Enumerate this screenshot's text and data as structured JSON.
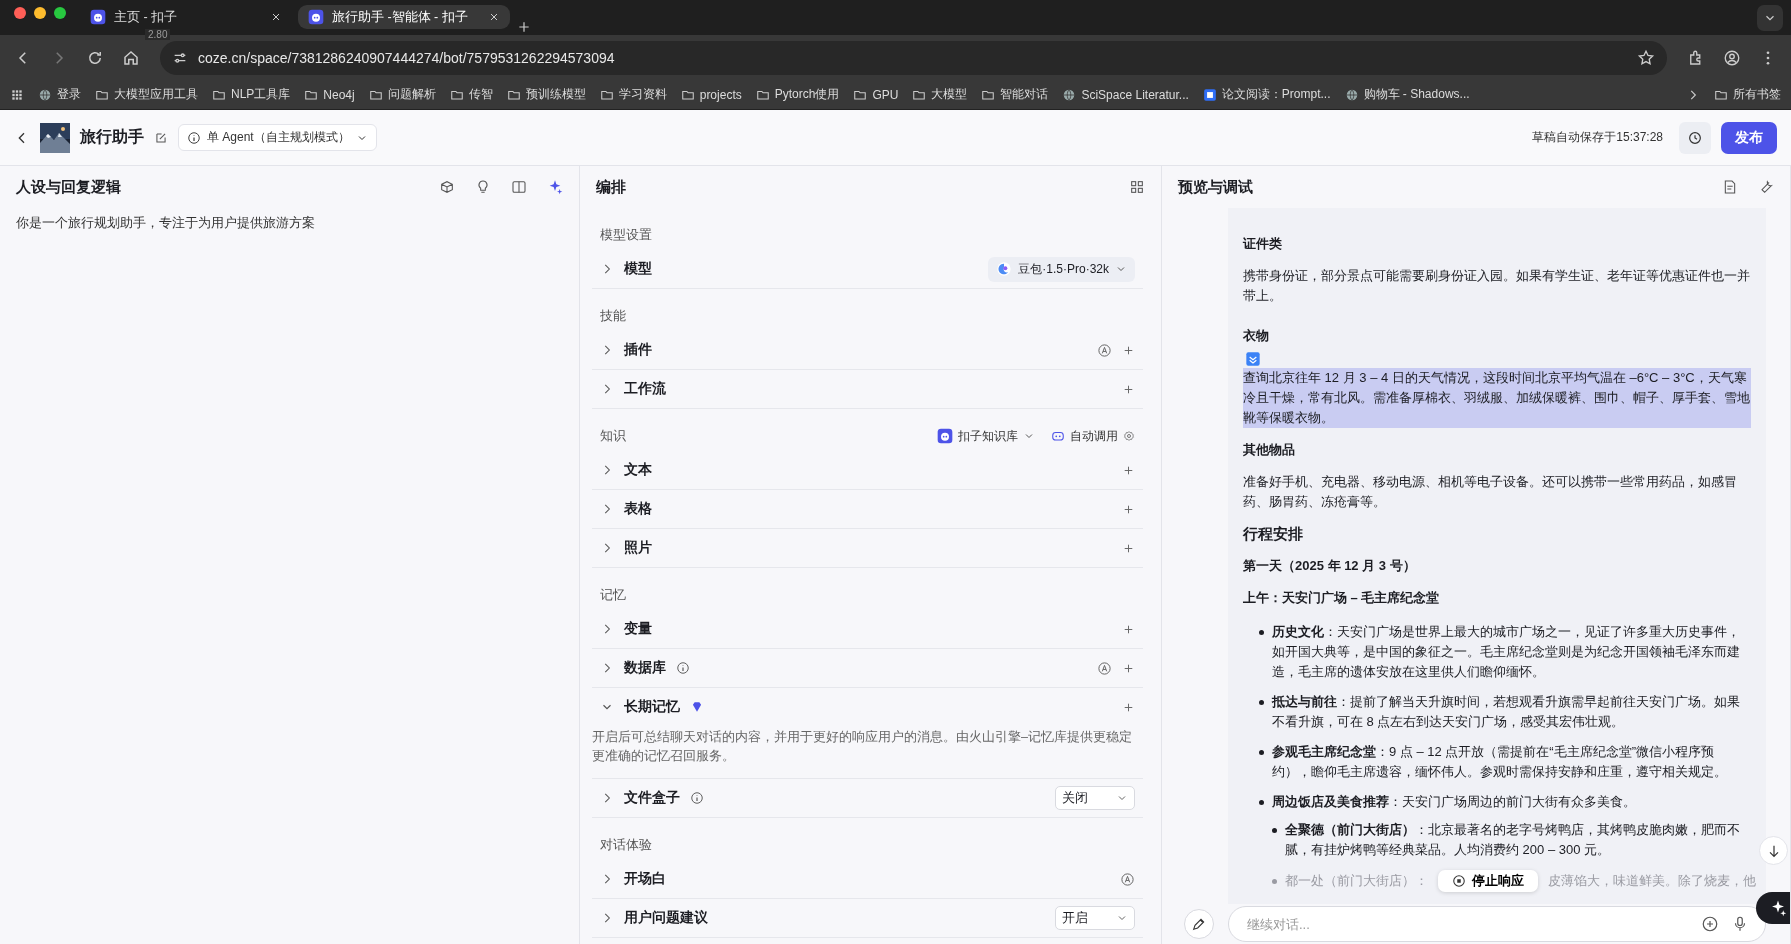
{
  "browser": {
    "tabs": [
      {
        "title": "主页 - 扣子",
        "selected": false
      },
      {
        "title": "旅行助手 -智能体 - 扣子",
        "selected": true
      }
    ],
    "tab_overlay": "2.80",
    "url": "coze.cn/space/7381286240907444274/bot/7579531262294573094",
    "bookmarks": [
      {
        "label": "登录",
        "kind": "site"
      },
      {
        "label": "大模型应用工具",
        "kind": "folder"
      },
      {
        "label": "NLP工具库",
        "kind": "folder"
      },
      {
        "label": "Neo4j",
        "kind": "folder"
      },
      {
        "label": "问题解析",
        "kind": "folder"
      },
      {
        "label": "传智",
        "kind": "folder"
      },
      {
        "label": "预训练模型",
        "kind": "folder"
      },
      {
        "label": "学习资料",
        "kind": "folder"
      },
      {
        "label": "projects",
        "kind": "folder"
      },
      {
        "label": "Pytorch使用",
        "kind": "folder"
      },
      {
        "label": "GPU",
        "kind": "folder"
      },
      {
        "label": "大模型",
        "kind": "folder"
      },
      {
        "label": "智能对话",
        "kind": "folder"
      },
      {
        "label": "SciSpace Literatur...",
        "kind": "site"
      },
      {
        "label": "论文阅读：Prompt...",
        "kind": "badge"
      },
      {
        "label": "购物车 - Shadows...",
        "kind": "site"
      }
    ],
    "all_bookmarks": "所有书签"
  },
  "header": {
    "title": "旅行助手",
    "mode": "单 Agent（自主规划模式）",
    "saved": "草稿自动保存于15:37:28",
    "publish": "发布"
  },
  "persona": {
    "title": "人设与回复逻辑",
    "prompt": "你是一个旅行规划助手，专注于为用户提供旅游方案"
  },
  "arrange": {
    "title": "编排",
    "sections": [
      {
        "title": "模型设置",
        "rows": [
          {
            "label": "模型",
            "expanded": false,
            "model": "豆包·1.5·Pro·32k"
          }
        ]
      },
      {
        "title": "技能",
        "rows": [
          {
            "label": "插件",
            "expanded": false,
            "auto": true,
            "add": true
          },
          {
            "label": "工作流",
            "expanded": false,
            "add": true
          }
        ]
      },
      {
        "title": "知识",
        "library": "扣子知识库",
        "invoke": "自动调用",
        "rows": [
          {
            "label": "文本",
            "expanded": false,
            "add": true
          },
          {
            "label": "表格",
            "expanded": false,
            "add": true
          },
          {
            "label": "照片",
            "expanded": false,
            "add": true
          }
        ]
      },
      {
        "title": "记忆",
        "rows": [
          {
            "label": "变量",
            "expanded": false,
            "add": true
          },
          {
            "label": "数据库",
            "expanded": false,
            "info": true,
            "auto": true,
            "add": true
          },
          {
            "label": "长期记忆",
            "expanded": true,
            "premium": true,
            "add": true,
            "description": "开启后可总结聊天对话的内容，并用于更好的响应用户的消息。由火山引擎–记忆库提供更稳定更准确的记忆召回服务。"
          },
          {
            "label": "文件盒子",
            "expanded": false,
            "info": true,
            "select": "关闭"
          }
        ]
      },
      {
        "title": "对话体验",
        "rows": [
          {
            "label": "开场白",
            "expanded": false,
            "auto": true
          },
          {
            "label": "用户问题建议",
            "expanded": false,
            "select": "开启"
          }
        ]
      }
    ]
  },
  "preview": {
    "title": "预览与调试",
    "messages": [
      {
        "kind": "heading",
        "text": "证件类"
      },
      {
        "kind": "paragraph",
        "text": "携带身份证，部分景点可能需要刷身份证入园。如果有学生证、老年证等优惠证件也一并带上。",
        "highlighted": false
      },
      {
        "kind": "heading",
        "text": "衣物",
        "tool_icon": true
      },
      {
        "kind": "paragraph",
        "text": "查询北京往年 12 月 3 – 4 日的天气情况，这段时间北京平均气温在 –6°C – 3°C，天气寒冷且干燥，常有北风。需准备厚棉衣、羽绒服、加绒保暖裤、围巾、帽子、厚手套、雪地靴等保暖衣物。",
        "highlighted": true
      },
      {
        "kind": "heading",
        "text": "其他物品"
      },
      {
        "kind": "paragraph",
        "text": "准备好手机、充电器、移动电源、相机等电子设备。还可以携带一些常用药品，如感冒药、肠胃药、冻疮膏等。",
        "highlighted": false
      },
      {
        "kind": "title",
        "text": "行程安排"
      },
      {
        "kind": "heading",
        "text": "第一天（2025 年 12 月 3 号）"
      },
      {
        "kind": "heading",
        "text": "上午：天安门广场 – 毛主席纪念堂"
      },
      {
        "kind": "bullet",
        "text": "**历史文化**：天安门广场是世界上最大的城市广场之一，见证了许多重大历史事件，如开国大典等，是中国的象征之一。毛主席纪念堂则是为纪念开国领袖毛泽东而建造，毛主席的遗体安放在这里供人们瞻仰缅怀。"
      },
      {
        "kind": "bullet",
        "text": "**抵达与前往**：提前了解当天升旗时间，若想观看升旗需早起前往天安门广场。如果不看升旗，可在 8 点左右到达天安门广场，感受其宏伟壮观。"
      },
      {
        "kind": "bullet",
        "text": "**参观毛主席纪念堂**：9 点 – 12 点开放（需提前在“毛主席纪念堂”微信小程序预约），瞻仰毛主席遗容，缅怀伟人。参观时需保持安静和庄重，遵守相关规定。"
      },
      {
        "kind": "bullet",
        "text": "**周边饭店及美食推荐**：天安门广场周边的前门大街有众多美食。",
        "children": [
          {
            "kind": "bullet",
            "text": "**全聚德（前门大街店）**：北京最著名的老字号烤鸭店，其烤鸭皮脆肉嫩，肥而不腻，有挂炉烤鸭等经典菜品。人均消费约 200 – 300 元。"
          },
          {
            "kind": "partial_bullet",
            "parts": [
              "都一处（前门大街店）：",
              "皮薄馅大，味道鲜美。除了烧麦，他"
            ]
          }
        ]
      }
    ],
    "stop": "停止响应",
    "input_placeholder": "继续对话..."
  }
}
